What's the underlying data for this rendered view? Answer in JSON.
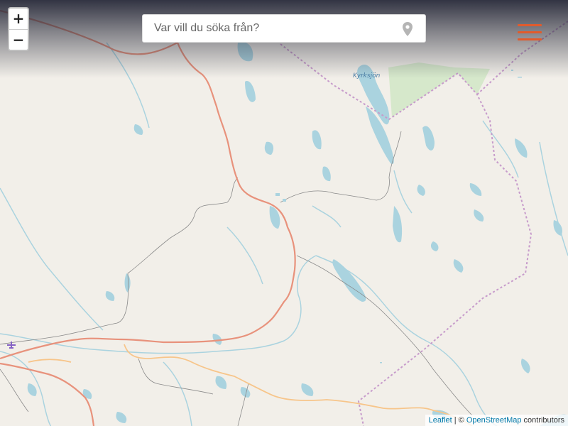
{
  "search": {
    "placeholder": "Var vill du söka från?"
  },
  "zoom": {
    "in_label": "+",
    "out_label": "−"
  },
  "attribution": {
    "leaflet": "Leaflet",
    "separator": " | © ",
    "osm": "OpenStreetMap",
    "contributors": " contributors"
  },
  "map": {
    "labels": {
      "lake": "Kyrksjön"
    }
  },
  "icons": {
    "location": "map-pin-icon",
    "menu": "hamburger-menu-icon",
    "airport": "airport-icon"
  },
  "colors": {
    "land": "#f2efe9",
    "water": "#aad3df",
    "forest": "#d6e8cb",
    "major_road": "#e8927c",
    "secondary_road": "#f7c58a",
    "minor_road": "#888888",
    "boundary": "#c79bcb",
    "menu": "#e25b2c"
  }
}
